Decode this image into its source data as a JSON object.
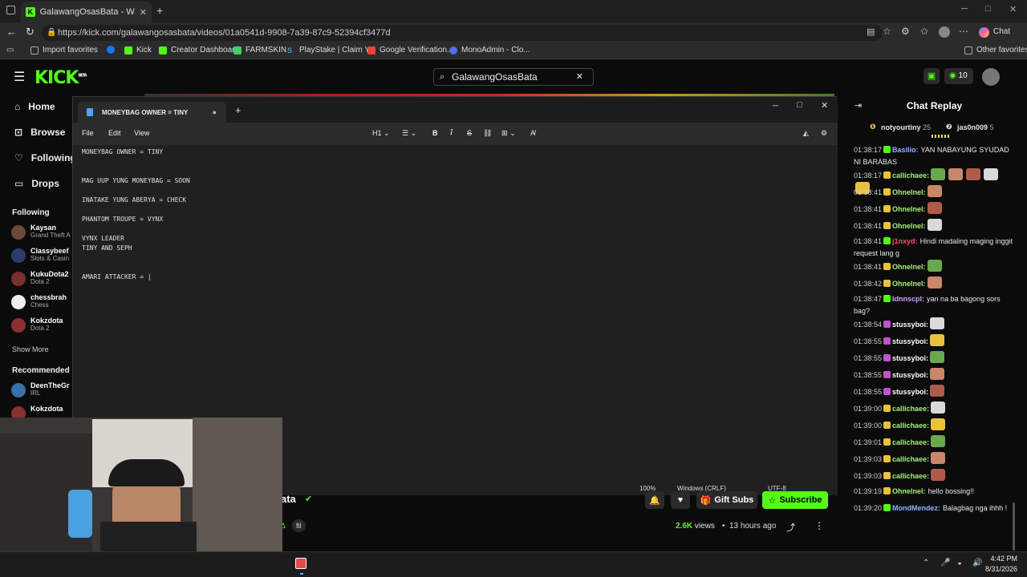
{
  "browser": {
    "tab_title": "GalawangOsasBata - Watch the VC",
    "url": "https://kick.com/galawangosasbata/videos/01a0541d-9908-7a39-87c9-52394cf3477d",
    "chat_label": "Chat",
    "bookmarks": [
      "Import favorites",
      "Kick",
      "Creator Dashboard",
      "FARMSKIN",
      "PlayStake | Claim Y...",
      "Google Verification...",
      "MonoAdmin - Clo..."
    ],
    "other_favorites": "Other favorites"
  },
  "site": {
    "logo": "KICK",
    "logo_badge": "BETA",
    "search_value": "GalawangOsasBata",
    "points": "10",
    "nav": [
      "Home",
      "Browse",
      "Following",
      "Drops"
    ],
    "following_label": "Following",
    "following_channels": [
      {
        "name": "Kaysan",
        "game": "Grand Theft A"
      },
      {
        "name": "Classybeef",
        "game": "Slots & Casin"
      },
      {
        "name": "KukuDota2",
        "game": "Dota 2"
      },
      {
        "name": "chessbrah",
        "game": "Chess"
      },
      {
        "name": "Kokzdota",
        "game": "Dota 2"
      }
    ],
    "show_more": "Show More",
    "recommended_label": "Recommended",
    "recommended_channels": [
      {
        "name": "DeenTheGr",
        "game": "IRL"
      },
      {
        "name": "Kokzdota",
        "game": ""
      }
    ]
  },
  "notepad": {
    "tab_title": "MONEYBAG OWNER = TINY",
    "menus": [
      "File",
      "Edit",
      "View"
    ],
    "heading_label": "H1",
    "lines": [
      "MONEYBAG OWNER = TINY",
      "",
      "",
      "MAG UUP YUNG MONEYBAG = SOON",
      "",
      "INATAKE YUNG ABERYA = CHECK",
      "",
      "PHANTOM TROUPE = VYNX",
      "",
      "VYNX LEADER",
      "TINY AND SEPH",
      "",
      "",
      "AMARI ATTACKER = |"
    ],
    "status_zoom": "100%",
    "status_eol": "Windows (CRLF)",
    "status_encoding": "UTF-8"
  },
  "stream": {
    "name_fragment": "ata",
    "tag": "fil",
    "gift_subs": "Gift Subs",
    "subscribe": "Subscribe",
    "views": "2.6K",
    "views_label": "views",
    "time_ago": "13 hours ago"
  },
  "chat": {
    "title": "Chat Replay",
    "top_gifters": [
      {
        "name": "notyourtiny",
        "count": "25"
      },
      {
        "name": "jas0n009",
        "count": "5"
      }
    ],
    "messages": [
      {
        "time": "01:38:17",
        "user": "Basilio:",
        "color": "#8fb4ff",
        "text": "YAN NABAYUNG SYUDAD NI BARABAS",
        "emotes": 0
      },
      {
        "time": "01:38:17",
        "user": "callichaee:",
        "color": "#a6f07a",
        "text": "",
        "emotes": 5
      },
      {
        "time": "01:38:41",
        "user": "Ohnelnel:",
        "color": "#a6f07a",
        "text": "",
        "emotes": 1
      },
      {
        "time": "01:38:41",
        "user": "Ohnelnel:",
        "color": "#a6f07a",
        "text": "",
        "emotes": 1
      },
      {
        "time": "01:38:41",
        "user": "Ohnelnel:",
        "color": "#a6f07a",
        "text": "",
        "emotes": 1
      },
      {
        "time": "01:38:41",
        "user": "j1nxyd:",
        "color": "#ff4d6d",
        "text": "Hindi madaling maging inggit request lang g",
        "emotes": 0
      },
      {
        "time": "01:38:41",
        "user": "Ohnelnel:",
        "color": "#a6f07a",
        "text": "",
        "emotes": 1
      },
      {
        "time": "01:38:42",
        "user": "Ohnelnel:",
        "color": "#a6f07a",
        "text": "",
        "emotes": 1
      },
      {
        "time": "01:38:47",
        "user": "Idnnscpl:",
        "color": "#c9a7ff",
        "text": "yan na ba bagong sors bag?",
        "emotes": 0
      },
      {
        "time": "01:38:54",
        "user": "stussyboi:",
        "color": "#ffffff",
        "text": "",
        "emotes": 1
      },
      {
        "time": "01:38:55",
        "user": "stussyboi:",
        "color": "#ffffff",
        "text": "",
        "emotes": 1
      },
      {
        "time": "01:38:55",
        "user": "stussyboi:",
        "color": "#ffffff",
        "text": "",
        "emotes": 1
      },
      {
        "time": "01:38:55",
        "user": "stussyboi:",
        "color": "#ffffff",
        "text": "",
        "emotes": 1
      },
      {
        "time": "01:38:55",
        "user": "stussyboi:",
        "color": "#ffffff",
        "text": "",
        "emotes": 1
      },
      {
        "time": "01:39:00",
        "user": "callichaee:",
        "color": "#a6f07a",
        "text": "",
        "emotes": 1
      },
      {
        "time": "01:39:00",
        "user": "callichaee:",
        "color": "#a6f07a",
        "text": "",
        "emotes": 1
      },
      {
        "time": "01:39:01",
        "user": "callichaee:",
        "color": "#a6f07a",
        "text": "",
        "emotes": 1
      },
      {
        "time": "01:39:03",
        "user": "callichaee:",
        "color": "#a6f07a",
        "text": "",
        "emotes": 1
      },
      {
        "time": "01:39:03",
        "user": "callichaee:",
        "color": "#a6f07a",
        "text": "",
        "emotes": 1
      },
      {
        "time": "01:39:19",
        "user": "Ohnelnel:",
        "color": "#a6f07a",
        "text": "hello bossing!!",
        "emotes": 0
      },
      {
        "time": "01:39:20",
        "user": "MondMendez:",
        "color": "#8fb4ff",
        "text": "Balagbag nga ihhh !",
        "emotes": 0
      }
    ]
  },
  "taskbar": {
    "time": "4:42 PM",
    "date": "8/31/2026"
  },
  "colors": {
    "kick_green": "#53fc18",
    "page_bg": "#0b0b0c",
    "notepad_bg": "#202020"
  }
}
